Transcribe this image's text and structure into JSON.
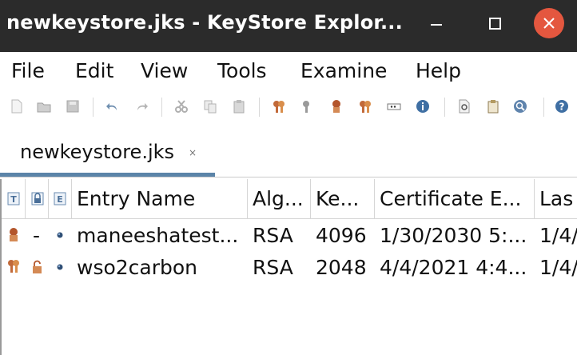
{
  "window": {
    "title": "newkeystore.jks - KeyStore Explor...",
    "controls": [
      "minimize-icon",
      "maximize-icon",
      "close-icon"
    ]
  },
  "menu": {
    "items": [
      "File",
      "Edit",
      "View",
      "Tools",
      "Examine",
      "Help"
    ]
  },
  "toolbar": {
    "icons": [
      "new-file-icon",
      "open-folder-icon",
      "save-icon",
      "undo-icon",
      "redo-icon",
      "cut-icon",
      "copy-icon",
      "paste-icon",
      "generate-key-pair-icon",
      "generate-secret-key-icon",
      "import-trusted-certificate-icon",
      "import-key-pair-icon",
      "set-password-icon",
      "properties-icon",
      "examine-file-icon",
      "examine-clipboard-icon",
      "examine-ssl-icon",
      "help-icon"
    ]
  },
  "tabs": [
    {
      "label": "newkeystore.jks",
      "close_glyph": "×"
    }
  ],
  "table": {
    "columns": [
      "T",
      "",
      "E",
      "Entry Name",
      "Alg...",
      "Ke...",
      "Certificate E...",
      "Las"
    ],
    "rows": [
      {
        "type_icon": "key-pair-icon",
        "lock": "-",
        "expiry_icon": "status-dot-icon",
        "name": "maneeshatest...",
        "alg": "RSA",
        "keysize": "4096",
        "cert_expiry": "1/30/2030 5:...",
        "last": "1/4/"
      },
      {
        "type_icon": "trusted-cert-icon",
        "lock": "unlocked-icon",
        "expiry_icon": "status-dot-icon",
        "name": "wso2carbon",
        "alg": "RSA",
        "keysize": "2048",
        "cert_expiry": "4/4/2021 4:4...",
        "last": "1/4/"
      }
    ]
  },
  "colors": {
    "titlebar_bg": "#2b2b2b",
    "close_button": "#e4573f",
    "tab_accent": "#5b84a8"
  }
}
